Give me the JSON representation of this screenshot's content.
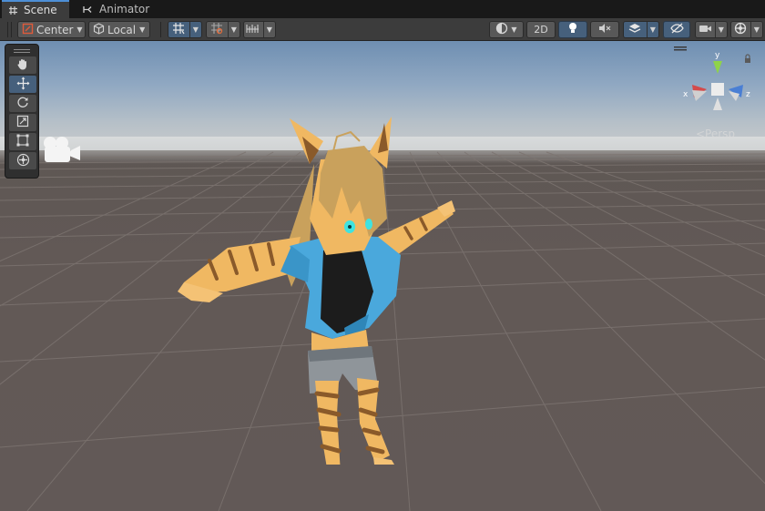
{
  "tabs": [
    {
      "label": "Scene",
      "icon": "hash-icon",
      "active": true
    },
    {
      "label": "Animator",
      "icon": "animator-icon",
      "active": false
    }
  ],
  "toolbar": {
    "pivot_mode": "Center",
    "pivot_rotation": "Local",
    "mode_2d": "2D"
  },
  "viewport": {
    "projection_label": "<Persp",
    "axis_labels": {
      "y": "y",
      "x": "x",
      "z": "z"
    }
  },
  "colors": {
    "accent_blue": "#46607c",
    "active_tab_border": "#4d8fd6",
    "axis_x": "#d44a4a",
    "axis_y": "#8fd34a",
    "axis_z": "#4a7fd4",
    "ground": "#625957",
    "sky_top": "#6f8fb2"
  }
}
